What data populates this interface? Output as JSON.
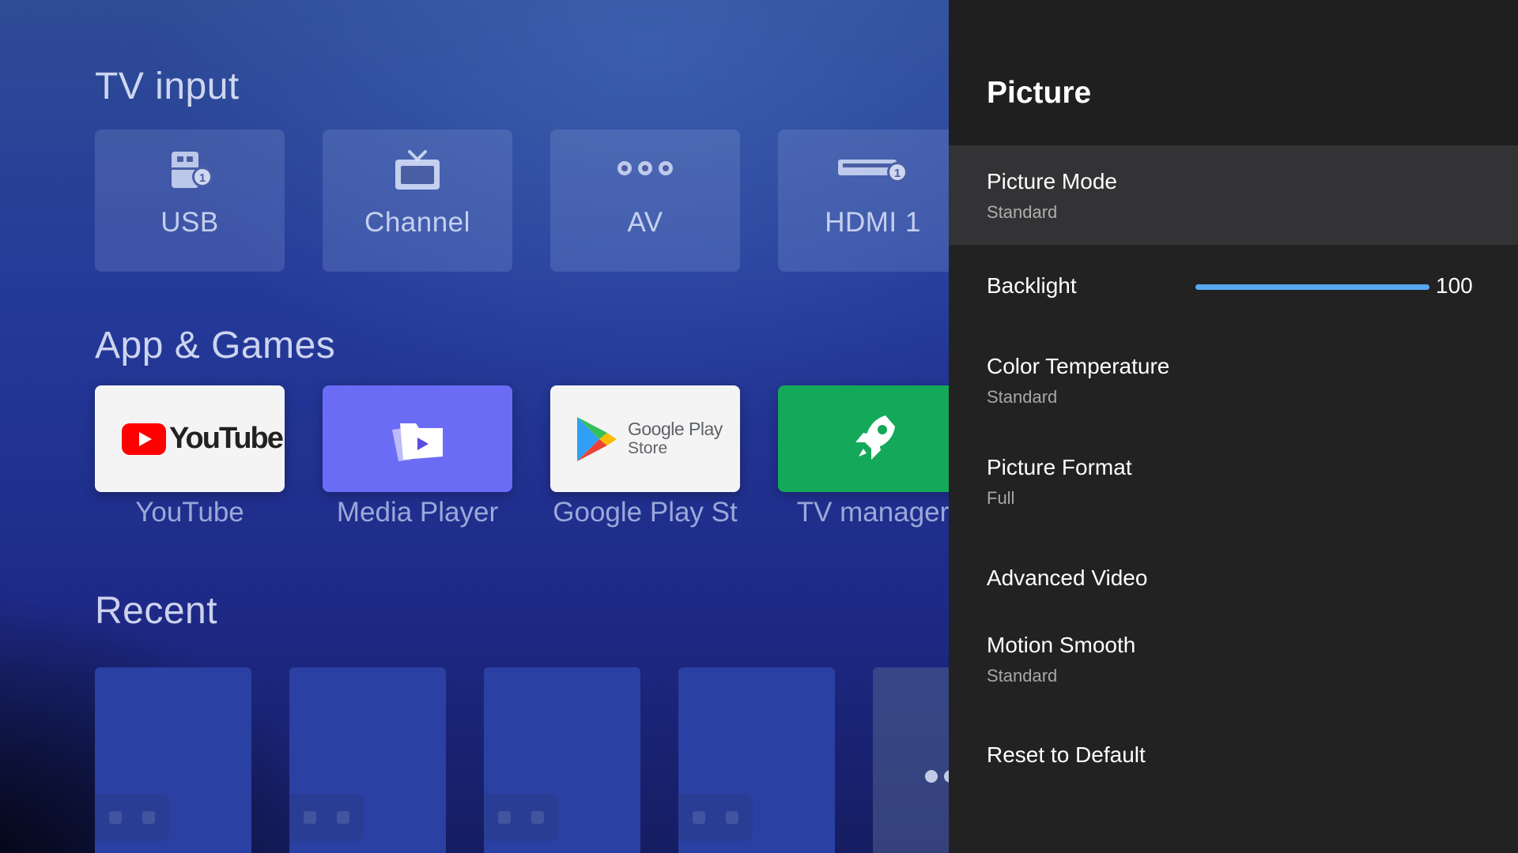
{
  "home": {
    "sections": {
      "tv_input": "TV input",
      "apps": "App & Games",
      "recent": "Recent"
    },
    "inputs": [
      {
        "label": "USB",
        "icon": "usb-drive-icon"
      },
      {
        "label": "Channel",
        "icon": "tv-channel-icon"
      },
      {
        "label": "AV",
        "icon": "av-connector-icon"
      },
      {
        "label": "HDMI 1",
        "icon": "hdmi-port-icon"
      }
    ],
    "apps": [
      {
        "label": "YouTube",
        "logo_text": "YouTube",
        "icon": "youtube-logo",
        "bg": "#f4f4f4"
      },
      {
        "label": "Media Player",
        "icon": "media-player-icon",
        "bg": "#6b6cf5"
      },
      {
        "label": "Google Play St",
        "logo_line1": "Google Play",
        "logo_line2": "Store",
        "icon": "google-play-logo",
        "bg": "#f4f4f4"
      },
      {
        "label": "TV manager",
        "icon": "rocket-icon",
        "bg": "#14a85a"
      }
    ]
  },
  "panel": {
    "title": "Picture",
    "items": [
      {
        "label": "Picture Mode",
        "value": "Standard"
      },
      {
        "label": "Backlight",
        "slider_value": "100",
        "slider_fraction": 1.0
      },
      {
        "label": "Color Temperature",
        "value": "Standard"
      },
      {
        "label": "Picture Format",
        "value": "Full"
      },
      {
        "label": "Advanced Video"
      },
      {
        "label": "Motion Smooth",
        "value": "Standard"
      },
      {
        "label": "Reset to Default"
      }
    ]
  },
  "colors": {
    "panel_bg": "#222223",
    "selected_row": "#333335",
    "slider_accent": "#57a8f0",
    "youtube_red": "#ff0000",
    "tv_manager_green": "#14a85a",
    "media_player_purple": "#6b6cf5"
  }
}
